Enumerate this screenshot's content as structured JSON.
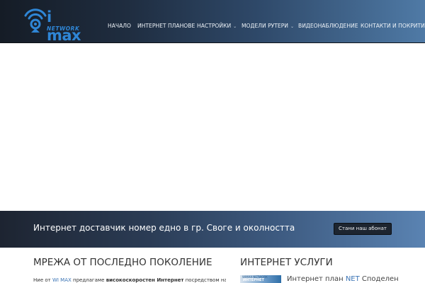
{
  "header": {
    "logo": {
      "wordmark": "i max",
      "subword": "NETWORK",
      "icon": "wifi-signal-icon"
    },
    "nav": [
      {
        "label": "НАЧАЛО",
        "has_dropdown": false
      },
      {
        "label": "ИНТЕРНЕТ ПЛАНОВЕ",
        "has_dropdown": false
      },
      {
        "label": "НАСТРОЙКИ",
        "has_dropdown": true
      },
      {
        "label": "МОДЕЛИ РУТЕРИ",
        "has_dropdown": true
      },
      {
        "label": "ВИДЕОНАБЛЮДЕНИЕ",
        "has_dropdown": false
      },
      {
        "label": "КОНТАКТИ И ПОКРИТИЕ",
        "has_dropdown": false
      }
    ],
    "caret": "⌄"
  },
  "banner": {
    "text": "Интернет доставчик номер едно в гр. Своге и околността",
    "button_label": "Стани наш абонат"
  },
  "main": {
    "left_title": "МРЕЖА ОТ ПОСЛЕДНО ПОКОЛЕНИЕ",
    "intro": {
      "before": "Ние от ",
      "brand": "WI MAX",
      "middle": " предлагаме ",
      "bold": "високоскоростен Интернет",
      "after": " посредством нашата"
    },
    "right_title": "ИНТЕРНЕТ УСЛУГИ",
    "service": {
      "thumb_small": "WIMAX NETWORK",
      "thumb_label": "ИНТЕРНЕТ",
      "title_before": "Интернет план ",
      "title_net": "NET",
      "title_after": " Споделен"
    }
  },
  "colors": {
    "brand_blue": "#2f86d6",
    "link_blue": "#3b74b5",
    "header_dark": "#151c26",
    "header_light": "#4f7aa6"
  }
}
